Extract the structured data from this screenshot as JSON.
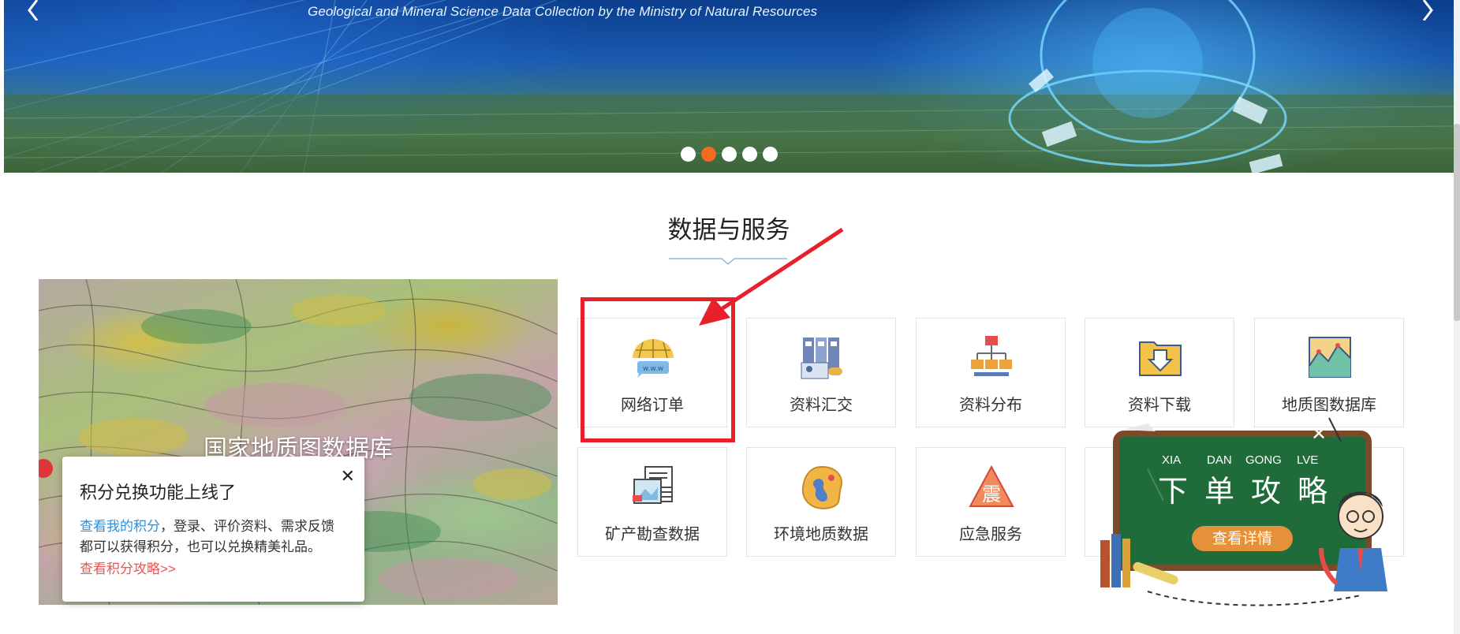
{
  "banner": {
    "subtitle": "Geological and Mineral Science Data Collection by the Ministry of Natural Resources",
    "prev_icon": "chevron-left-icon",
    "next_icon": "chevron-right-icon",
    "slides": 5,
    "active_slide": 2,
    "active_color": "#f26b21"
  },
  "section": {
    "title": "数据与服务"
  },
  "map_panel": {
    "title": "国家地质图数据库"
  },
  "points_popup": {
    "title": "积分兑换功能上线了",
    "link_text": "查看我的积分",
    "body_text": "，登录、评价资料、需求反馈都可以获得积分，也可以兑换精美礼品。",
    "guide_link": "查看积分攻略>>",
    "close_symbol": "✕"
  },
  "services": [
    {
      "label": "网络订单",
      "icon": "globe-www-icon"
    },
    {
      "label": "资料汇交",
      "icon": "binders-icon"
    },
    {
      "label": "资料分布",
      "icon": "network-distribution-icon"
    },
    {
      "label": "资料下载",
      "icon": "folder-download-icon"
    },
    {
      "label": "地质图数据库",
      "icon": "map-chart-icon"
    },
    {
      "label": "矿产勘查数据",
      "icon": "mineral-data-icon"
    },
    {
      "label": "环境地质数据",
      "icon": "environment-palette-icon"
    },
    {
      "label": "应急服务",
      "icon": "earthquake-warning-icon"
    }
  ],
  "order_guide": {
    "pinyin": [
      "XIA",
      "DAN",
      "GONG",
      "LVE"
    ],
    "characters": [
      "下",
      "单",
      "攻",
      "略"
    ],
    "button_label": "查看详情",
    "close_symbol": "✕"
  },
  "colors": {
    "highlight": "#e8202a",
    "link_blue": "#2f8fd9",
    "link_red": "#e85454",
    "chalkboard": "#1f6b3a"
  }
}
